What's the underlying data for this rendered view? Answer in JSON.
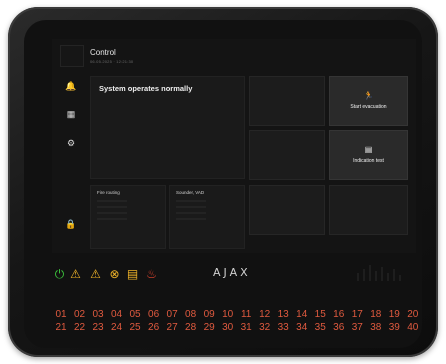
{
  "header": {
    "title": "Control",
    "subtitle": "06.05.2025 · 12:21:30"
  },
  "main_panel": {
    "status_text": "System operates normally"
  },
  "columns": {
    "fire_routing": "Fire routing",
    "sounder_vad": "Sounder, VAD"
  },
  "tiles": {
    "start_evacuation": {
      "label": "Start evacuation",
      "icon": "running-person-icon"
    },
    "indication_test": {
      "label": "Indication test",
      "icon": "test-panel-icon"
    }
  },
  "sidebar": {
    "items": [
      {
        "icon": "bell-icon",
        "glyph": "🔔"
      },
      {
        "icon": "grid-icon",
        "glyph": "▦"
      },
      {
        "icon": "settings-icon",
        "glyph": "⚙"
      },
      {
        "icon": "lock-icon",
        "glyph": "🔒"
      }
    ]
  },
  "status_indicators": [
    {
      "name": "power-icon",
      "glyph": "⏻",
      "color": "#3cc43c"
    },
    {
      "name": "fault-warning-icon",
      "glyph": "⚠",
      "color": "#f0b428"
    },
    {
      "name": "warning-icon",
      "glyph": "⚠",
      "color": "#f0b428"
    },
    {
      "name": "disabled-icon",
      "glyph": "⊗",
      "color": "#f0b428"
    },
    {
      "name": "test-icon",
      "glyph": "▤",
      "color": "#f0b428"
    },
    {
      "name": "fire-icon",
      "glyph": "♨",
      "color": "#e8452f"
    }
  ],
  "brand": {
    "name": "AJAX"
  },
  "zones": {
    "row1": [
      "01",
      "02",
      "03",
      "04",
      "05",
      "06",
      "07",
      "08",
      "09",
      "10",
      "11",
      "12",
      "13",
      "14",
      "15",
      "16",
      "17",
      "18",
      "19",
      "20"
    ],
    "row2": [
      "21",
      "22",
      "23",
      "24",
      "25",
      "26",
      "27",
      "28",
      "29",
      "30",
      "31",
      "32",
      "33",
      "34",
      "35",
      "36",
      "37",
      "38",
      "39",
      "40"
    ],
    "color": "#e05a3f"
  }
}
